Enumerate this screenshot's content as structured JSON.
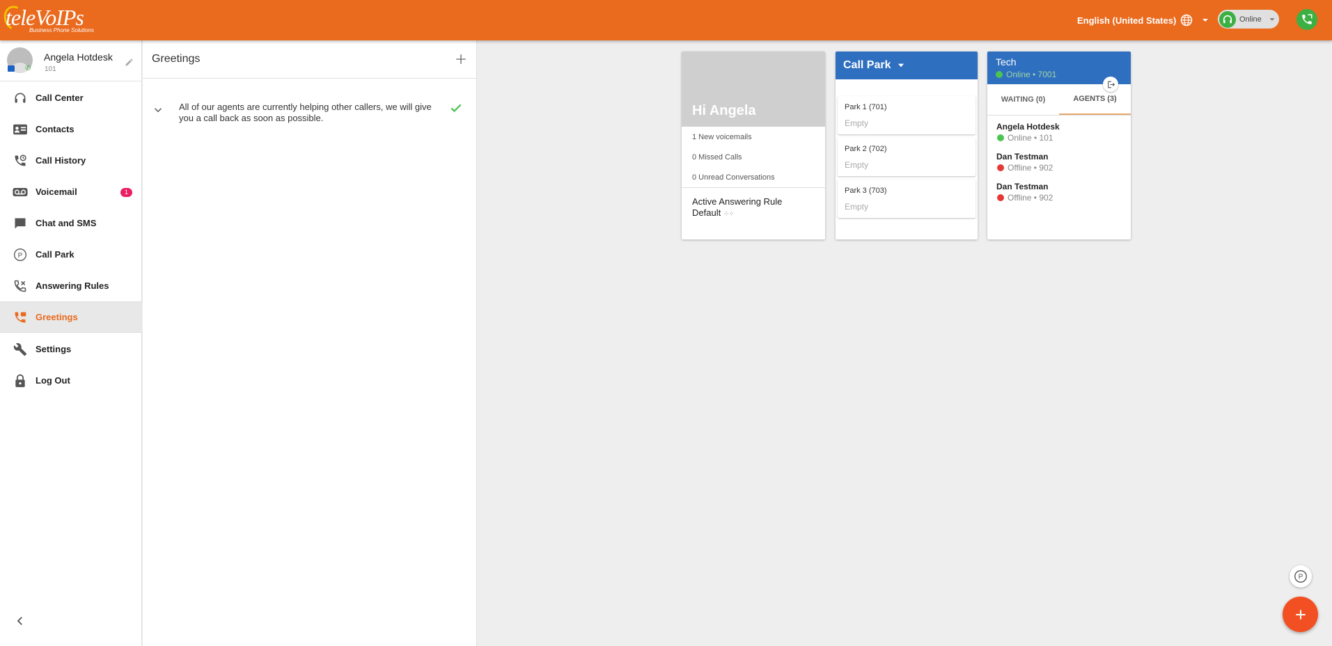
{
  "brand": {
    "logo_text": "teleVoIPs",
    "tagline": "Business Phone Solutions",
    "accent_color": "#ea6a1e"
  },
  "header": {
    "language": "English (United States)",
    "status": "Online"
  },
  "profile": {
    "name": "Angela Hotdesk",
    "extension": "101"
  },
  "sidebar": {
    "items": [
      {
        "label": "Call Center",
        "icon": "headset-icon"
      },
      {
        "label": "Contacts",
        "icon": "contact-card-icon"
      },
      {
        "label": "Call History",
        "icon": "call-history-icon"
      },
      {
        "label": "Voicemail",
        "icon": "voicemail-icon",
        "badge": "1"
      },
      {
        "label": "Chat and SMS",
        "icon": "chat-icon"
      },
      {
        "label": "Call Park",
        "icon": "park-icon"
      },
      {
        "label": "Answering Rules",
        "icon": "answering-rules-icon"
      },
      {
        "label": "Greetings",
        "icon": "greetings-icon",
        "active": true
      },
      {
        "label": "Settings",
        "icon": "wrench-icon"
      },
      {
        "label": "Log Out",
        "icon": "lock-icon"
      }
    ]
  },
  "greetings": {
    "title": "Greetings",
    "items": [
      {
        "text": "All of our agents are currently helping other callers, we will give you a call back as soon as possible.",
        "active": true
      }
    ]
  },
  "summary_card": {
    "title": "Hi Angela",
    "lines": [
      "1 New voicemails",
      "0 Missed Calls",
      "0 Unread Conversations"
    ],
    "rule_label": "Active Answering Rule",
    "rule_value": "Default"
  },
  "call_park_card": {
    "title": "Call Park",
    "slots": [
      {
        "name": "Park 1 (701)",
        "status": "Empty"
      },
      {
        "name": "Park 2 (702)",
        "status": "Empty"
      },
      {
        "name": "Park 3 (703)",
        "status": "Empty"
      }
    ]
  },
  "queue_card": {
    "name": "Tech",
    "status": "Online • 7001",
    "tabs": [
      "WAITING (0)",
      "AGENTS (3)"
    ],
    "active_tab": 1,
    "agents": [
      {
        "name": "Angela Hotdesk",
        "status": "Online • 101",
        "color": "#4cc452"
      },
      {
        "name": "Dan Testman",
        "status": "Offline • 902",
        "color": "#e53935"
      },
      {
        "name": "Dan Testman",
        "status": "Offline • 902",
        "color": "#e53935"
      }
    ]
  }
}
